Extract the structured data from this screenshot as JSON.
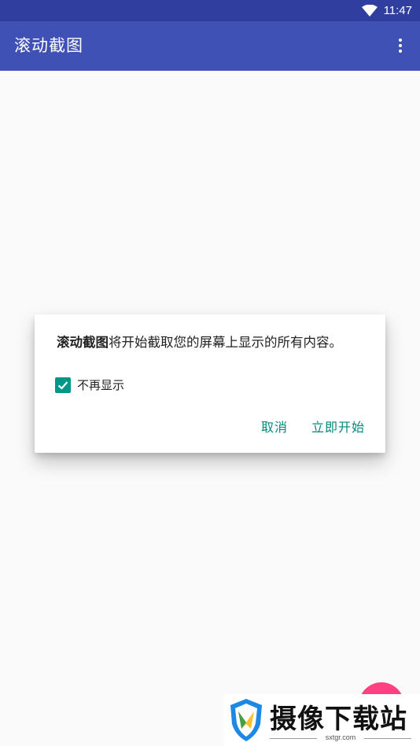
{
  "status_bar": {
    "time": "11:47",
    "wifi_icon": "wifi-icon"
  },
  "app_bar": {
    "title": "滚动截图",
    "menu_icon": "more-vert-icon"
  },
  "dialog": {
    "message_strong": "滚动截图",
    "message_rest": "将开始截取您的屏幕上显示的所有内容。",
    "checkbox_label": "不再显示",
    "checkbox_checked": true,
    "cancel_label": "取消",
    "start_label": "立即开始"
  },
  "watermark": {
    "brand": "摄像下载站",
    "url": "sxtgr.com"
  },
  "colors": {
    "primary": "#3f51b5",
    "primary_dark": "#303f9f",
    "accent": "#ff4081",
    "teal": "#009688"
  }
}
